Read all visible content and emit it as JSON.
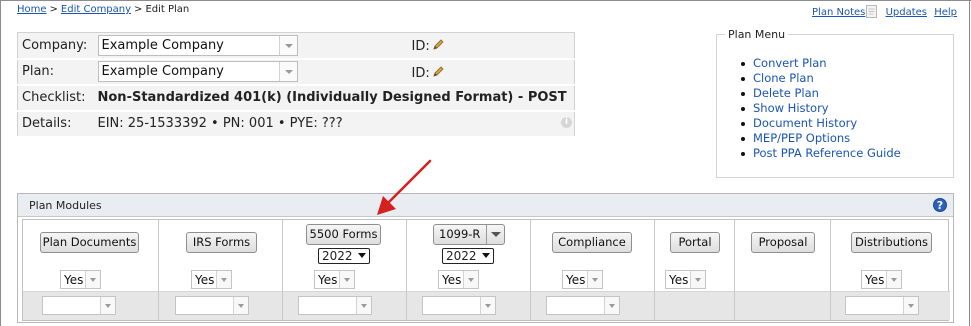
{
  "breadcrumb": {
    "home": "Home",
    "sep": ">",
    "edit_company": "Edit Company",
    "current": "Edit Plan"
  },
  "top_links": {
    "plan_notes": "Plan Notes",
    "updates": "Updates",
    "help": "Help"
  },
  "info": {
    "company_label": "Company:",
    "company_value": "Example Company",
    "plan_label": "Plan:",
    "plan_value": "Example Company",
    "id_label": "ID:",
    "checklist_label": "Checklist:",
    "checklist_value": "Non-Standardized 401(k) (Individually Designed Format) - POST",
    "details_label": "Details:",
    "details_value": "EIN: 25-1533392 • PN: 001 • PYE: ???"
  },
  "plan_menu": {
    "title": "Plan Menu",
    "items": [
      "Convert Plan",
      "Clone Plan",
      "Delete Plan",
      "Show History",
      "Document History",
      "MEP/PEP Options",
      "Post PPA Reference Guide"
    ]
  },
  "modules": {
    "title": "Plan Modules",
    "help_glyph": "?",
    "columns": [
      {
        "label": "Plan Documents",
        "status": "Yes"
      },
      {
        "label": "IRS Forms",
        "status": "Yes"
      },
      {
        "label": "5500 Forms",
        "year": "2022",
        "status": "Yes"
      },
      {
        "label": "1099-R",
        "year": "2022",
        "status": "Yes"
      },
      {
        "label": "Compliance",
        "status": "Yes"
      },
      {
        "label": "Portal",
        "status": "Yes"
      },
      {
        "label": "Proposal"
      },
      {
        "label": "Distributions",
        "status": "Yes"
      }
    ]
  },
  "colors": {
    "link": "#1a55b3",
    "annotation_arrow": "#d42020",
    "modules_header": "#e9edf1",
    "help_icon": "#2b62b7"
  },
  "icons": [
    "notes-icon",
    "pencil-icon",
    "info-icon",
    "help-icon",
    "dropdown-arrow-icon"
  ]
}
